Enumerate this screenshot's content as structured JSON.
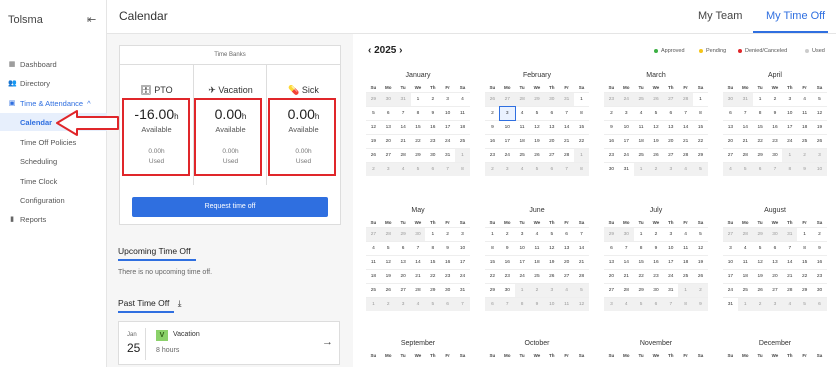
{
  "sidebar": {
    "brand": "Tolsma",
    "collapse_icon": "collapse-sidebar-icon",
    "items": [
      {
        "label": "Dashboard",
        "icon": "dashboard-icon"
      },
      {
        "label": "Directory",
        "icon": "people-icon"
      },
      {
        "label": "Time & Attendance",
        "icon": "calendar-icon",
        "chevron": "^"
      },
      {
        "label": "Calendar"
      },
      {
        "label": "Time Off Policies"
      },
      {
        "label": "Scheduling"
      },
      {
        "label": "Time Clock"
      },
      {
        "label": "Configuration"
      },
      {
        "label": "Reports",
        "icon": "bar-chart-icon"
      }
    ]
  },
  "header": {
    "title": "Calendar",
    "tabs": [
      {
        "label": "My Team"
      },
      {
        "label": "My Time Off"
      }
    ],
    "active_tab": "My Time Off"
  },
  "time_banks": {
    "title": "Time Banks",
    "banks": [
      {
        "name": "PTO",
        "value": "-16.00",
        "unit": "h",
        "available_label": "Available",
        "used_value": "0.00h",
        "used_label": "Used",
        "icon": "briefcase-icon"
      },
      {
        "name": "Vacation",
        "value": "0.00",
        "unit": "h",
        "available_label": "Available",
        "used_value": "0.00h",
        "used_label": "Used",
        "icon": "airplane-icon"
      },
      {
        "name": "Sick",
        "value": "0.00",
        "unit": "h",
        "available_label": "Available",
        "used_value": "0.00h",
        "used_label": "Used",
        "icon": "pills-icon"
      }
    ],
    "request_button": "Request time off"
  },
  "upcoming": {
    "title": "Upcoming Time Off",
    "empty_text": "There is no upcoming time off."
  },
  "past": {
    "title": "Past Time Off",
    "download_icon": "download-icon",
    "entries": [
      {
        "month": "Jan",
        "day": "25",
        "badge": "V",
        "type": "Vacation",
        "hours": "8 hours"
      }
    ]
  },
  "calendar": {
    "year": "2025",
    "prev": "‹",
    "next": "›",
    "weekdays": [
      "Su",
      "Mo",
      "Tu",
      "We",
      "Th",
      "Fr",
      "Sa"
    ],
    "legend": [
      {
        "label": "Approved",
        "color": "#3cb043"
      },
      {
        "label": "Pending",
        "color": "#f5c518"
      },
      {
        "label": "Denied/Canceled",
        "color": "#e0262a"
      },
      {
        "label": "Used",
        "color": "#cccccc"
      }
    ],
    "months": [
      {
        "name": "January",
        "weeks": [
          [
            "29",
            "30",
            "31",
            "1",
            "2",
            "3",
            "4"
          ],
          [
            "5",
            "6",
            "7",
            "8",
            "9",
            "10",
            "11"
          ],
          [
            "12",
            "13",
            "14",
            "15",
            "16",
            "17",
            "18"
          ],
          [
            "19",
            "20",
            "21",
            "22",
            "23",
            "24",
            "25"
          ],
          [
            "26",
            "27",
            "28",
            "29",
            "30",
            "31",
            "1"
          ],
          [
            "2",
            "3",
            "4",
            "5",
            "6",
            "7",
            "8"
          ]
        ]
      },
      {
        "name": "February",
        "weeks": [
          [
            "26",
            "27",
            "28",
            "29",
            "30",
            "31",
            "1"
          ],
          [
            "2",
            "3",
            "4",
            "5",
            "6",
            "7",
            "8"
          ],
          [
            "9",
            "10",
            "11",
            "12",
            "13",
            "14",
            "15"
          ],
          [
            "16",
            "17",
            "18",
            "19",
            "20",
            "21",
            "22"
          ],
          [
            "23",
            "24",
            "25",
            "26",
            "27",
            "28",
            "1"
          ],
          [
            "2",
            "3",
            "4",
            "5",
            "6",
            "7",
            "8"
          ]
        ]
      },
      {
        "name": "March",
        "weeks": [
          [
            "23",
            "24",
            "25",
            "26",
            "27",
            "28",
            "1"
          ],
          [
            "2",
            "3",
            "4",
            "5",
            "6",
            "7",
            "8"
          ],
          [
            "9",
            "10",
            "11",
            "12",
            "13",
            "14",
            "15"
          ],
          [
            "16",
            "17",
            "18",
            "19",
            "20",
            "21",
            "22"
          ],
          [
            "23",
            "24",
            "25",
            "26",
            "27",
            "28",
            "29"
          ],
          [
            "30",
            "31",
            "1",
            "2",
            "3",
            "4",
            "5"
          ]
        ]
      },
      {
        "name": "April",
        "weeks": [
          [
            "30",
            "31",
            "1",
            "2",
            "3",
            "4",
            "5"
          ],
          [
            "6",
            "7",
            "8",
            "9",
            "10",
            "11",
            "12"
          ],
          [
            "13",
            "14",
            "15",
            "16",
            "17",
            "18",
            "19"
          ],
          [
            "20",
            "21",
            "22",
            "23",
            "24",
            "25",
            "26"
          ],
          [
            "27",
            "28",
            "29",
            "30",
            "1",
            "2",
            "3"
          ],
          [
            "4",
            "5",
            "6",
            "7",
            "8",
            "9",
            "10"
          ]
        ]
      },
      {
        "name": "May",
        "weeks": [
          [
            "27",
            "28",
            "29",
            "30",
            "1",
            "2",
            "3"
          ],
          [
            "4",
            "5",
            "6",
            "7",
            "8",
            "9",
            "10"
          ],
          [
            "11",
            "12",
            "13",
            "14",
            "15",
            "16",
            "17"
          ],
          [
            "18",
            "19",
            "20",
            "21",
            "22",
            "23",
            "24"
          ],
          [
            "25",
            "26",
            "27",
            "28",
            "29",
            "30",
            "31"
          ],
          [
            "1",
            "2",
            "3",
            "4",
            "5",
            "6",
            "7"
          ]
        ]
      },
      {
        "name": "June",
        "weeks": [
          [
            "1",
            "2",
            "3",
            "4",
            "5",
            "6",
            "7"
          ],
          [
            "8",
            "9",
            "10",
            "11",
            "12",
            "13",
            "14"
          ],
          [
            "15",
            "16",
            "17",
            "18",
            "19",
            "20",
            "21"
          ],
          [
            "22",
            "23",
            "24",
            "25",
            "26",
            "27",
            "28"
          ],
          [
            "29",
            "30",
            "1",
            "2",
            "3",
            "4",
            "5"
          ],
          [
            "6",
            "7",
            "8",
            "9",
            "10",
            "11",
            "12"
          ]
        ]
      },
      {
        "name": "July",
        "weeks": [
          [
            "29",
            "30",
            "1",
            "2",
            "3",
            "4",
            "5"
          ],
          [
            "6",
            "7",
            "8",
            "9",
            "10",
            "11",
            "12"
          ],
          [
            "13",
            "14",
            "15",
            "16",
            "17",
            "18",
            "19"
          ],
          [
            "20",
            "21",
            "22",
            "23",
            "24",
            "25",
            "26"
          ],
          [
            "27",
            "28",
            "29",
            "30",
            "31",
            "1",
            "2"
          ],
          [
            "3",
            "4",
            "5",
            "6",
            "7",
            "8",
            "9"
          ]
        ]
      },
      {
        "name": "August",
        "weeks": [
          [
            "27",
            "28",
            "29",
            "30",
            "31",
            "1",
            "2"
          ],
          [
            "3",
            "4",
            "5",
            "6",
            "7",
            "8",
            "9"
          ],
          [
            "10",
            "11",
            "12",
            "13",
            "14",
            "15",
            "16"
          ],
          [
            "17",
            "18",
            "19",
            "20",
            "21",
            "22",
            "23"
          ],
          [
            "24",
            "25",
            "26",
            "27",
            "28",
            "29",
            "30"
          ],
          [
            "31",
            "1",
            "2",
            "3",
            "4",
            "5",
            "6"
          ]
        ]
      },
      {
        "name": "September",
        "weeks": []
      },
      {
        "name": "October",
        "weeks": []
      },
      {
        "name": "November",
        "weeks": []
      },
      {
        "name": "December",
        "weeks": []
      }
    ]
  },
  "annotation": {
    "box_color": "#e0262a"
  }
}
